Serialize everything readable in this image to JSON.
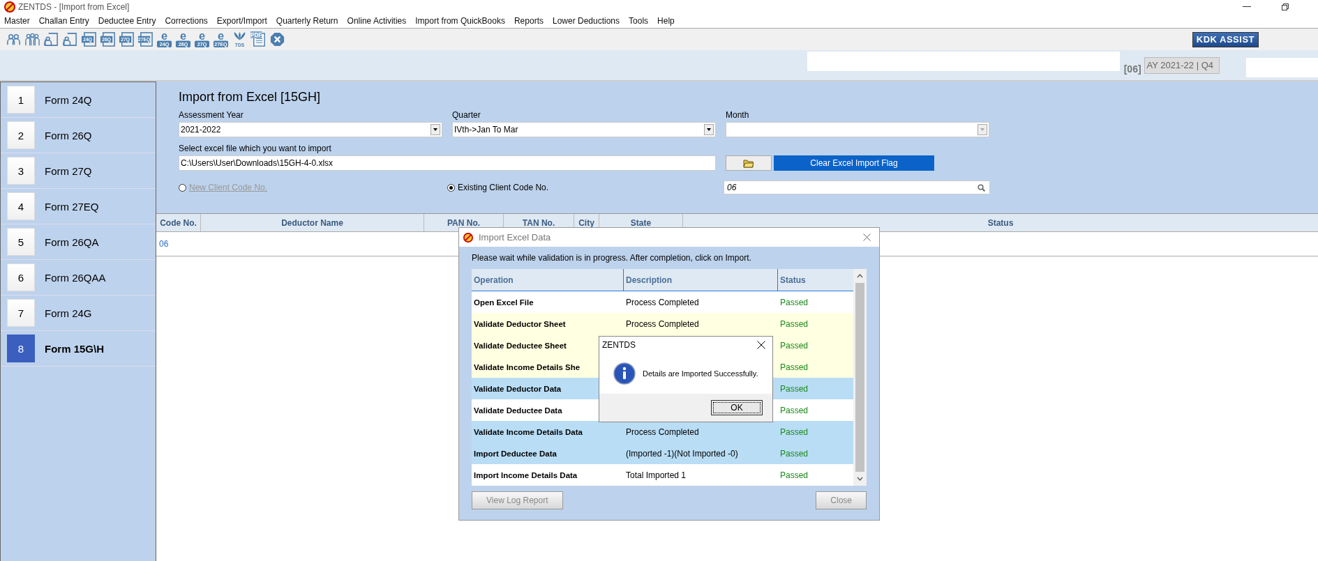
{
  "window": {
    "title": "ZENTDS - [Import from Excel]"
  },
  "menu": [
    "Master",
    "Challan Entry",
    "Deductee Entry",
    "Corrections",
    "Export/Import",
    "Quarterly Return",
    "Online Activities",
    "Import from QuickBooks",
    "Reports",
    "Lower Deductions",
    "Tools",
    "Help"
  ],
  "toolbar": [
    {
      "kind": "people"
    },
    {
      "kind": "group"
    },
    {
      "kind": "person_form"
    },
    {
      "kind": "person_form"
    },
    {
      "kind": "form",
      "label": "24Q"
    },
    {
      "kind": "form",
      "label": "26Q"
    },
    {
      "kind": "form",
      "label": "27Q"
    },
    {
      "kind": "form",
      "label": "27EQ"
    },
    {
      "kind": "eform",
      "letter": "e",
      "label": "24Q"
    },
    {
      "kind": "eform",
      "letter": "e",
      "label": "26Q"
    },
    {
      "kind": "eform",
      "letter": "e",
      "label": "27Q"
    },
    {
      "kind": "eform",
      "letter": "e",
      "label": "27EQ"
    },
    {
      "kind": "tds",
      "label": "TDS"
    },
    {
      "kind": "pdf",
      "label": "PDF"
    },
    {
      "kind": "close"
    }
  ],
  "assist_button": "KDK ASSIST",
  "client_code": "[06]",
  "period": "AY 2021-22 | Q4",
  "sidebar": {
    "items": [
      {
        "number": "1",
        "label": "Form 24Q",
        "selected": false
      },
      {
        "number": "2",
        "label": "Form 26Q",
        "selected": false
      },
      {
        "number": "3",
        "label": "Form 27Q",
        "selected": false
      },
      {
        "number": "4",
        "label": "Form 27EQ",
        "selected": false
      },
      {
        "number": "5",
        "label": "Form 26QA",
        "selected": false
      },
      {
        "number": "6",
        "label": "Form 26QAA",
        "selected": false
      },
      {
        "number": "7",
        "label": "Form 24G",
        "selected": false
      },
      {
        "number": "8",
        "label": "Form 15G\\H",
        "selected": true
      }
    ]
  },
  "form": {
    "title": "Import from Excel [15GH]",
    "fields": [
      {
        "label": "Assessment Year",
        "value": "2021-2022",
        "disabled": false
      },
      {
        "label": "Quarter",
        "value": "IVth->Jan To Mar",
        "disabled": false
      },
      {
        "label": "Month",
        "disabled": true
      }
    ],
    "file_label": "Select excel file which you want to import",
    "file_value": "C:\\Users\\User\\Downloads\\15GH-4-0.xlsx",
    "clear_button": "Clear Excel Import Flag",
    "radios": [
      {
        "label": "New Client Code No.",
        "selected": false,
        "disabled": true
      },
      {
        "label": "Existing Client Code No.",
        "selected": true,
        "disabled": false
      }
    ],
    "search_value": "06"
  },
  "table": {
    "columns": [
      "Code No.",
      "Deductor Name",
      "PAN No.",
      "TAN No.",
      "City",
      "State",
      "Status"
    ],
    "rows": [
      {
        "code": "06"
      }
    ]
  },
  "import_dialog": {
    "title": "Import Excel Data",
    "message": "Please wait while validation is in progress. After completion, click on Import.",
    "columns": [
      "Operation",
      "Description",
      "Status"
    ],
    "rows": [
      {
        "operation": "Open Excel File",
        "description": "Process Completed",
        "status": "Passed",
        "color": "#ffffff"
      },
      {
        "operation": "Validate Deductor Sheet",
        "description": "Process Completed",
        "status": "Passed",
        "color": "#ffffe1"
      },
      {
        "operation": "Validate Deductee Sheet",
        "status": "Passed",
        "color": "#ffffe1"
      },
      {
        "operation": "Validate Income Details She",
        "status": "Passed",
        "color": "#ffffe1"
      },
      {
        "operation": "Validate Deductor Data",
        "status": "Passed",
        "color": "#b9ddf5"
      },
      {
        "operation": "Validate Deductee Data",
        "status": "Passed",
        "color": "#ffffff"
      },
      {
        "operation": "Validate Income Details Data",
        "description": "Process Completed",
        "status": "Passed",
        "color": "#b9ddf5"
      },
      {
        "operation": "Import Deductee Data",
        "description": "(Imported -1)(Not Imported -0)",
        "status": "Passed",
        "color": "#b9ddf5"
      },
      {
        "operation": "Import Income Details Data",
        "description": "Total Imported 1",
        "status": "Passed",
        "color": "#ffffff"
      }
    ],
    "buttons": [
      {
        "label": "View Log Report",
        "disabled": true
      },
      {
        "label": "Close",
        "disabled": true
      }
    ]
  },
  "message_box": {
    "title": "ZENTDS",
    "message": "Details are Imported Successfully.",
    "button": "OK"
  }
}
